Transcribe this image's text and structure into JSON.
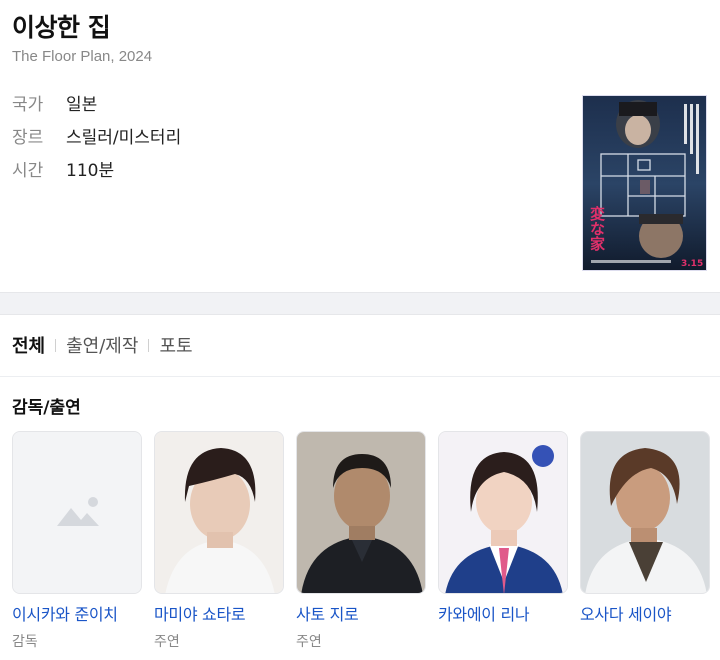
{
  "movie": {
    "title": "이상한 집",
    "subtitle": "The Floor Plan, 2024",
    "info": [
      {
        "label": "국가",
        "value": "일본"
      },
      {
        "label": "장르",
        "value": "스릴러/미스터리"
      },
      {
        "label": "시간",
        "value": "110분"
      }
    ],
    "poster": {
      "title_glyphs": "変な家",
      "date_text": "3.15"
    }
  },
  "tabs": [
    "전체",
    "출연/제작",
    "포토"
  ],
  "active_tab": "전체",
  "section": {
    "title": "감독/출연"
  },
  "cast": [
    {
      "name": "이시카와 준이치",
      "role": "감독",
      "photo": "placeholder-image-icon"
    },
    {
      "name": "마미야 쇼타로",
      "role": "주연",
      "photo": "actor-portrait"
    },
    {
      "name": "사토 지로",
      "role": "주연",
      "photo": "actor-portrait"
    },
    {
      "name": "카와에이 리나",
      "role": "",
      "photo": "actor-portrait"
    },
    {
      "name": "오사다 세이야",
      "role": "",
      "photo": "actor-portrait"
    }
  ],
  "colors": {
    "link": "#1a55c7",
    "muted": "#888888",
    "band": "#f1f2f5",
    "poster_accent": "#e0306a"
  }
}
